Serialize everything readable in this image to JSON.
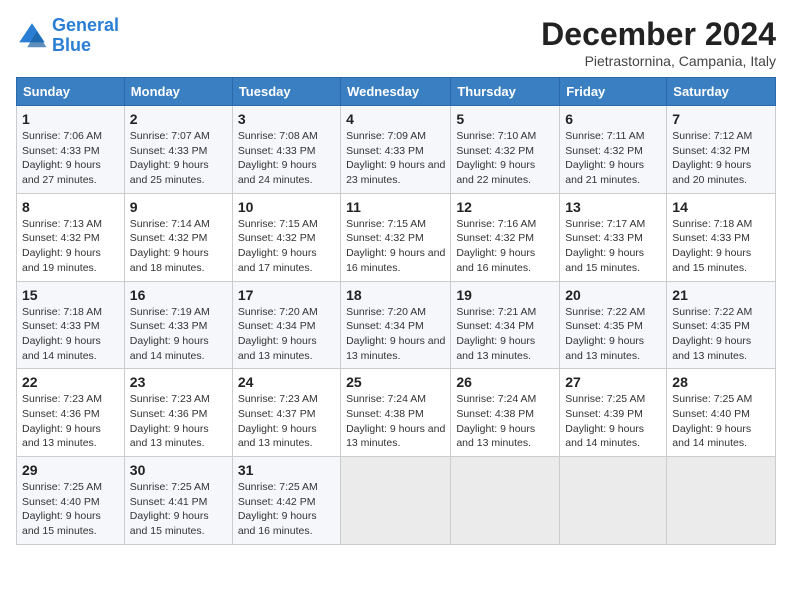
{
  "header": {
    "logo_line1": "General",
    "logo_line2": "Blue",
    "month": "December 2024",
    "location": "Pietrastornina, Campania, Italy"
  },
  "days_of_week": [
    "Sunday",
    "Monday",
    "Tuesday",
    "Wednesday",
    "Thursday",
    "Friday",
    "Saturday"
  ],
  "weeks": [
    [
      {
        "day": "1",
        "info": "Sunrise: 7:06 AM\nSunset: 4:33 PM\nDaylight: 9 hours and 27 minutes."
      },
      {
        "day": "2",
        "info": "Sunrise: 7:07 AM\nSunset: 4:33 PM\nDaylight: 9 hours and 25 minutes."
      },
      {
        "day": "3",
        "info": "Sunrise: 7:08 AM\nSunset: 4:33 PM\nDaylight: 9 hours and 24 minutes."
      },
      {
        "day": "4",
        "info": "Sunrise: 7:09 AM\nSunset: 4:33 PM\nDaylight: 9 hours and 23 minutes."
      },
      {
        "day": "5",
        "info": "Sunrise: 7:10 AM\nSunset: 4:32 PM\nDaylight: 9 hours and 22 minutes."
      },
      {
        "day": "6",
        "info": "Sunrise: 7:11 AM\nSunset: 4:32 PM\nDaylight: 9 hours and 21 minutes."
      },
      {
        "day": "7",
        "info": "Sunrise: 7:12 AM\nSunset: 4:32 PM\nDaylight: 9 hours and 20 minutes."
      }
    ],
    [
      {
        "day": "8",
        "info": "Sunrise: 7:13 AM\nSunset: 4:32 PM\nDaylight: 9 hours and 19 minutes."
      },
      {
        "day": "9",
        "info": "Sunrise: 7:14 AM\nSunset: 4:32 PM\nDaylight: 9 hours and 18 minutes."
      },
      {
        "day": "10",
        "info": "Sunrise: 7:15 AM\nSunset: 4:32 PM\nDaylight: 9 hours and 17 minutes."
      },
      {
        "day": "11",
        "info": "Sunrise: 7:15 AM\nSunset: 4:32 PM\nDaylight: 9 hours and 16 minutes."
      },
      {
        "day": "12",
        "info": "Sunrise: 7:16 AM\nSunset: 4:32 PM\nDaylight: 9 hours and 16 minutes."
      },
      {
        "day": "13",
        "info": "Sunrise: 7:17 AM\nSunset: 4:33 PM\nDaylight: 9 hours and 15 minutes."
      },
      {
        "day": "14",
        "info": "Sunrise: 7:18 AM\nSunset: 4:33 PM\nDaylight: 9 hours and 15 minutes."
      }
    ],
    [
      {
        "day": "15",
        "info": "Sunrise: 7:18 AM\nSunset: 4:33 PM\nDaylight: 9 hours and 14 minutes."
      },
      {
        "day": "16",
        "info": "Sunrise: 7:19 AM\nSunset: 4:33 PM\nDaylight: 9 hours and 14 minutes."
      },
      {
        "day": "17",
        "info": "Sunrise: 7:20 AM\nSunset: 4:34 PM\nDaylight: 9 hours and 13 minutes."
      },
      {
        "day": "18",
        "info": "Sunrise: 7:20 AM\nSunset: 4:34 PM\nDaylight: 9 hours and 13 minutes."
      },
      {
        "day": "19",
        "info": "Sunrise: 7:21 AM\nSunset: 4:34 PM\nDaylight: 9 hours and 13 minutes."
      },
      {
        "day": "20",
        "info": "Sunrise: 7:22 AM\nSunset: 4:35 PM\nDaylight: 9 hours and 13 minutes."
      },
      {
        "day": "21",
        "info": "Sunrise: 7:22 AM\nSunset: 4:35 PM\nDaylight: 9 hours and 13 minutes."
      }
    ],
    [
      {
        "day": "22",
        "info": "Sunrise: 7:23 AM\nSunset: 4:36 PM\nDaylight: 9 hours and 13 minutes."
      },
      {
        "day": "23",
        "info": "Sunrise: 7:23 AM\nSunset: 4:36 PM\nDaylight: 9 hours and 13 minutes."
      },
      {
        "day": "24",
        "info": "Sunrise: 7:23 AM\nSunset: 4:37 PM\nDaylight: 9 hours and 13 minutes."
      },
      {
        "day": "25",
        "info": "Sunrise: 7:24 AM\nSunset: 4:38 PM\nDaylight: 9 hours and 13 minutes."
      },
      {
        "day": "26",
        "info": "Sunrise: 7:24 AM\nSunset: 4:38 PM\nDaylight: 9 hours and 13 minutes."
      },
      {
        "day": "27",
        "info": "Sunrise: 7:25 AM\nSunset: 4:39 PM\nDaylight: 9 hours and 14 minutes."
      },
      {
        "day": "28",
        "info": "Sunrise: 7:25 AM\nSunset: 4:40 PM\nDaylight: 9 hours and 14 minutes."
      }
    ],
    [
      {
        "day": "29",
        "info": "Sunrise: 7:25 AM\nSunset: 4:40 PM\nDaylight: 9 hours and 15 minutes."
      },
      {
        "day": "30",
        "info": "Sunrise: 7:25 AM\nSunset: 4:41 PM\nDaylight: 9 hours and 15 minutes."
      },
      {
        "day": "31",
        "info": "Sunrise: 7:25 AM\nSunset: 4:42 PM\nDaylight: 9 hours and 16 minutes."
      },
      null,
      null,
      null,
      null
    ]
  ]
}
